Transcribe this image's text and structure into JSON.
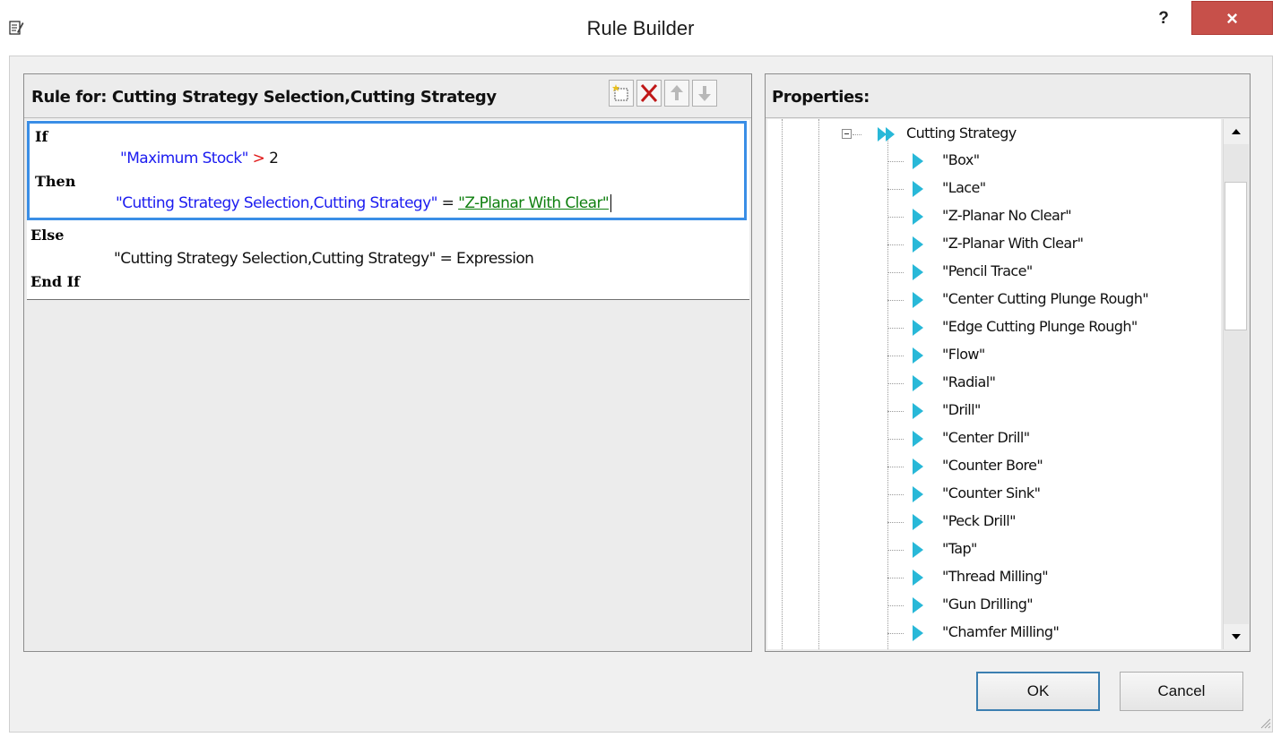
{
  "window": {
    "title": "Rule Builder",
    "help_label": "?",
    "close_label": "×"
  },
  "rule_panel": {
    "header": "Rule for: Cutting Strategy Selection,Cutting Strategy",
    "toolbar": [
      "new-rule-icon",
      "delete-icon",
      "move-up-icon",
      "move-down-icon"
    ],
    "if_keyword": "If",
    "condition_field": "\"Maximum Stock\"",
    "condition_operator": ">",
    "condition_value": "2",
    "then_keyword": "Then",
    "then_target": "\"Cutting Strategy Selection,Cutting Strategy\"",
    "then_operator": "=",
    "then_value": "\"Z-Planar With Clear\"",
    "else_keyword": "Else",
    "else_statement": "\"Cutting Strategy Selection,Cutting Strategy\" = Expression",
    "endif_keyword": "End If"
  },
  "properties_panel": {
    "header": "Properties:",
    "root_label": "Cutting Strategy",
    "items": [
      "\"Box\"",
      "\"Lace\"",
      "\"Z-Planar No Clear\"",
      "\"Z-Planar With Clear\"",
      "\"Pencil Trace\"",
      "\"Center Cutting Plunge Rough\"",
      "\"Edge Cutting Plunge Rough\"",
      "\"Flow\"",
      "\"Radial\"",
      "\"Drill\"",
      "\"Center Drill\"",
      "\"Counter Bore\"",
      "\"Counter Sink\"",
      "\"Peck Drill\"",
      "\"Tap\"",
      "\"Thread Milling\"",
      "\"Gun Drilling\"",
      "\"Chamfer Milling\""
    ]
  },
  "buttons": {
    "ok": "OK",
    "cancel": "Cancel"
  },
  "colors": {
    "selection_border": "#3a8ee6",
    "field_text": "#1c1cf0",
    "operator_text": "#e01818",
    "value_text": "#108010",
    "tree_arrow": "#28b8d8",
    "close_button": "#c7504a"
  }
}
